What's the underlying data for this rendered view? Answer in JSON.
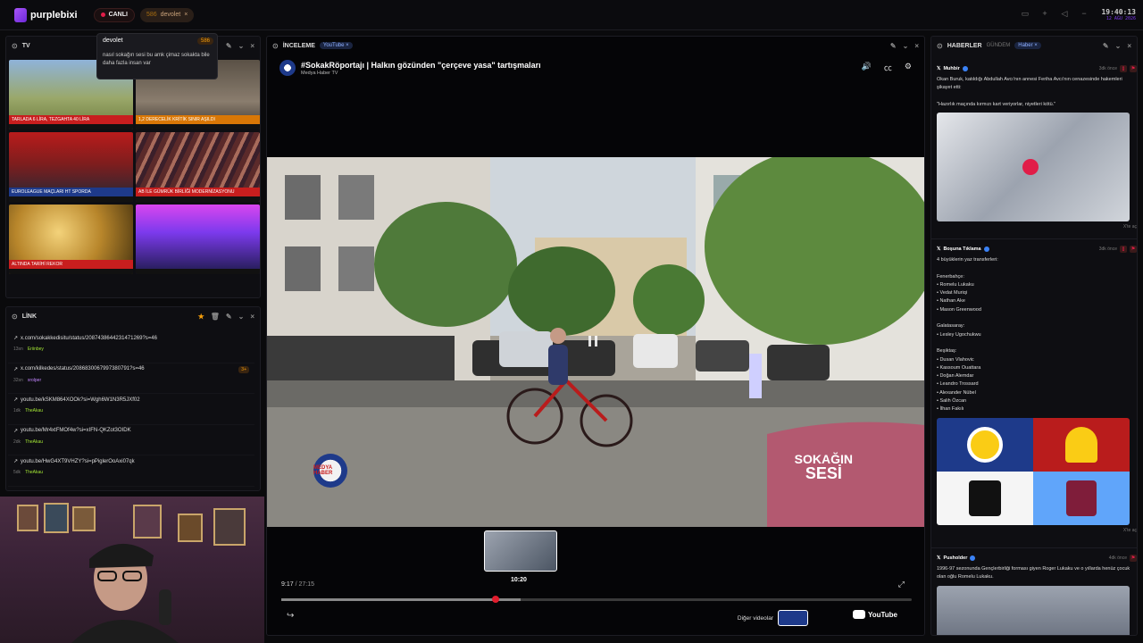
{
  "topbar": {
    "brand": "purplebixi",
    "live_label": "CANLI",
    "user_count": "586",
    "user_name": "devolet",
    "time": "19:40:13",
    "date": "12 AĞU 2026"
  },
  "tv": {
    "title": "TV",
    "tickers": [
      "TARLADA 6 LİRA, TEZGAHTA 40 LİRA",
      "1,2 DERECELİK KRİTİK SINIR AŞILDI",
      "EUROLEAGUE MAÇLARI HT SPORDA",
      "AB İLE GÜMRÜK BİRLİĞİ MODERNİZASYONU",
      "ALTINDA TARİHİ REKOR",
      ""
    ]
  },
  "chat_popup": {
    "user": "devolet",
    "badge": "586",
    "message": "nasıl sokağın sesi bu amk çimaz sokakta bile daha fazla insan var"
  },
  "link": {
    "title": "LİNK",
    "items": [
      {
        "url": "x.com/sokakkedisitu/status/2087438644231471269?s=46",
        "time": "13sn",
        "user": "Eriinbey",
        "count": ""
      },
      {
        "url": "x.com/kilkedes/status/2086830067997380791?s=46",
        "time": "32sn",
        "user": "xrolper",
        "count": "3+"
      },
      {
        "url": "youtu.be/kSKM864XOOk?si=Wgh6W1N3R5JXf02",
        "time": "1dk",
        "user": "TheAkau",
        "count": ""
      },
      {
        "url": "youtu.be/Mr4xtFMOf4w?si=xIFN-QKZot3OIDK",
        "time": "2dk",
        "user": "TheAkau",
        "count": ""
      },
      {
        "url": "youtu.be/HwG4XT9VHZY?si=pPiglerOoAxi07qk",
        "time": "5dk",
        "user": "TheAkau",
        "count": ""
      }
    ]
  },
  "inceleme": {
    "title": "İNCELEME",
    "tag": "YouTube",
    "video_title": "#SokakRöportajı | Halkın gözünden \"çerçeve yasa\" tartışmaları",
    "channel": "Medya Haber TV",
    "current_time": "9:17",
    "duration": "27:15",
    "hover_time": "10:20",
    "progress": 0.34,
    "hover_progress": 0.38,
    "overlay_text_1": "SOKAĞIN",
    "overlay_text_2": "SESİ",
    "logo_text": "MEDYA HABER",
    "others_label": "Diğer videolar",
    "youtube_label": "YouTube"
  },
  "news": {
    "title": "HABERLER",
    "tab2": "GÜNDEM",
    "tag": "Haber",
    "items": [
      {
        "author": "Muhbir",
        "ago": "3dk önce",
        "text": "Okan Buruk, katıldığı Abdullah Avcı'nın annesi Feriha Avcı'nın cenazesinde hakemleri şikayet etti:\n\n\"Hazırlık maçında kırmızı kart veriyorlar, niyetleri kötü.\"",
        "link": "X'te aç"
      },
      {
        "author": "Boşuna Tıklama",
        "ago": "3dk önce",
        "text": "4 büyüklerin yaz transferleri:\n\nFenerbahçe:\n• Romelu Lukaku\n• Vedat Muriqi\n• Nathan Ake\n• Mason Greenwood\n\nGalatasaray:\n• Lesley Ugochukwu\n\nBeşiktaş:\n• Dusan Vlahovic\n• Kassoum Ouattara\n• Doğan Alemdar\n• Leandro Trossard\n• Alexander Nübel\n• Salih Özcan\n• İlhan Fakılı",
        "link": "X'te aç"
      },
      {
        "author": "Pusholder",
        "ago": "4dk önce",
        "text": "1996-97 sezonunda Gençlerbirliği forması giyen Roger Lukaku ve o yıllarda henüz çocuk olan oğlu Romelu Lukaku.",
        "link": ""
      }
    ]
  },
  "colors": {
    "accent": "#7c3aed",
    "live": "#e11d48",
    "progress": "#e11d2d",
    "verified": "#3b82f6"
  }
}
